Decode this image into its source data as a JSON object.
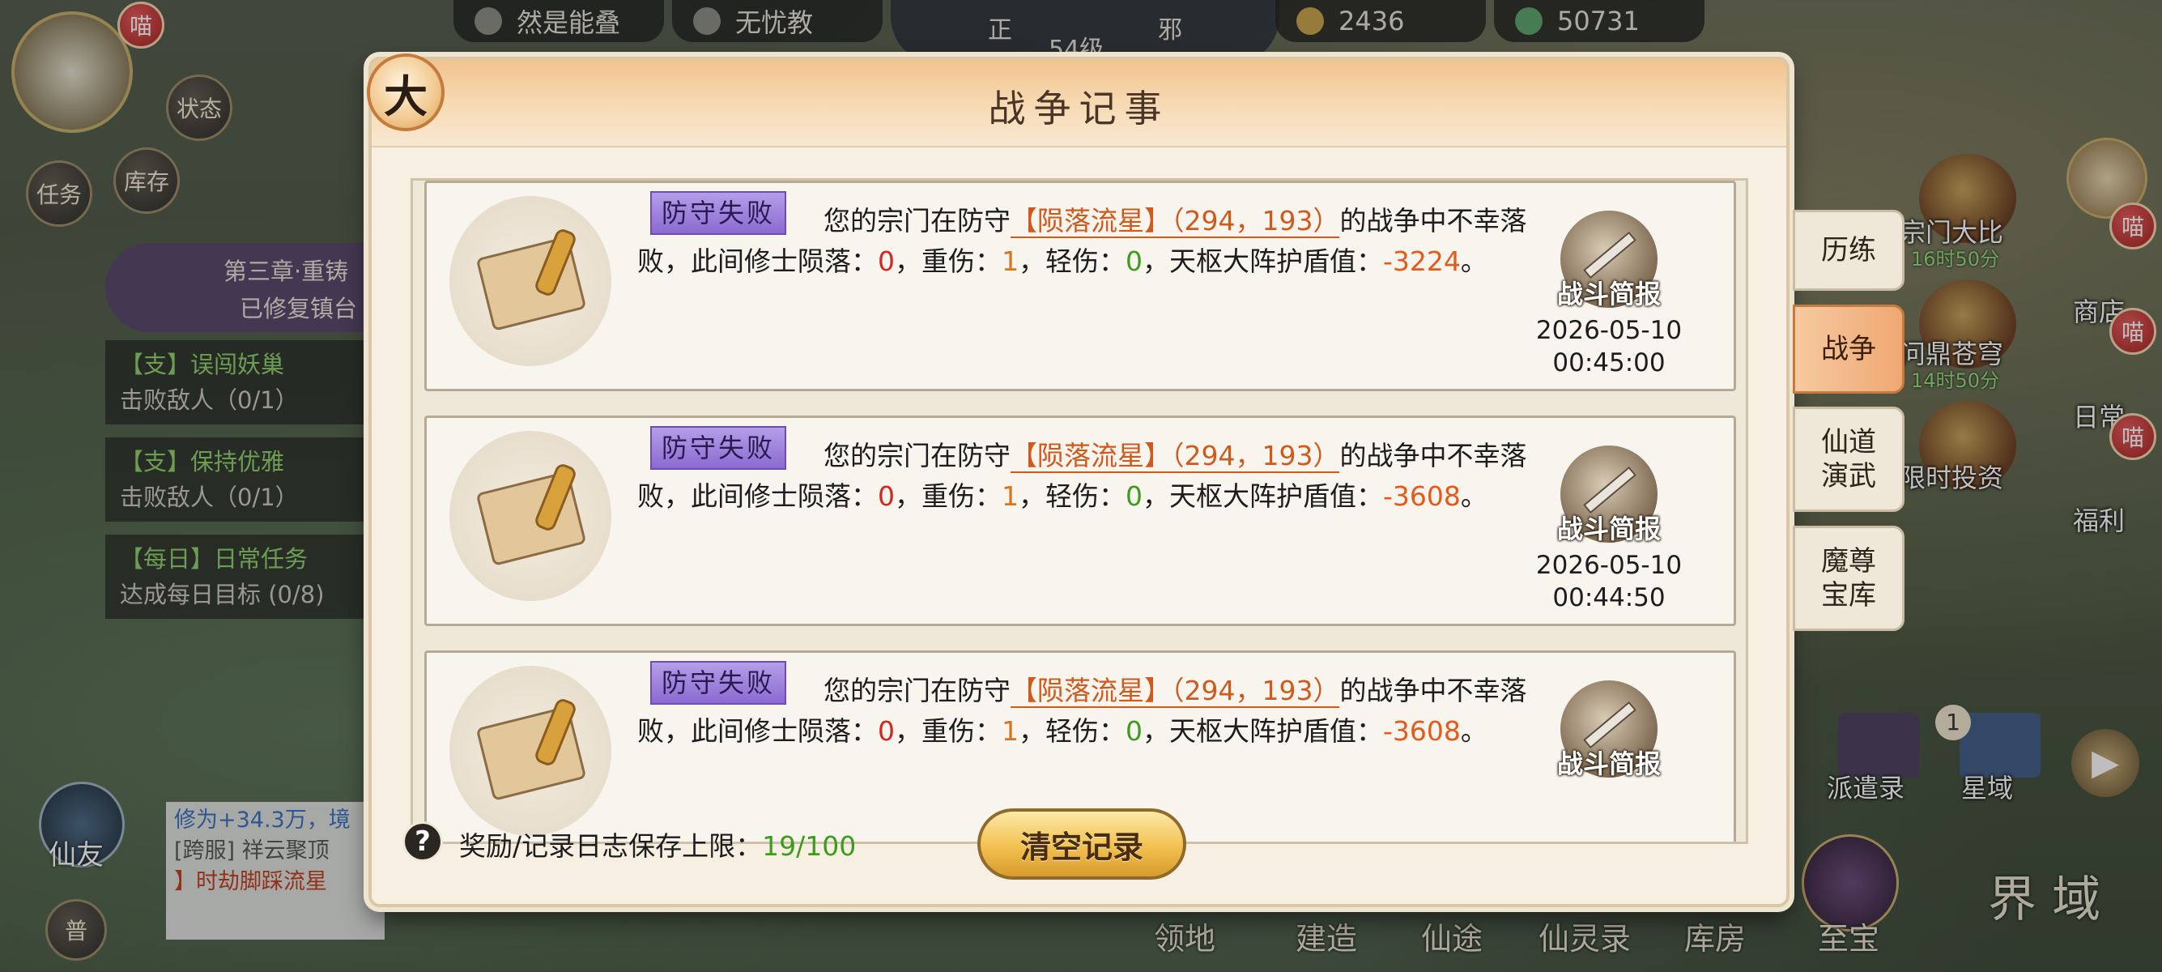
{
  "top_bar": {
    "sect_label": "然是能叠",
    "faction_label": "无忧教",
    "level_label": "54级",
    "alignment_left": "正",
    "alignment_right": "邪",
    "spirit_stones": "2436",
    "currency": "50731"
  },
  "left_hud": {
    "notify_badge": "喵",
    "status_label": "状态",
    "storage_label": "库存",
    "task_label": "任务",
    "chapter_title": "第三章·重铸",
    "chapter_sub": "已修复镇台",
    "quests": [
      {
        "title": "【支】误闯妖巢",
        "desc": "击败敌人（0/1）"
      },
      {
        "title": "【支】保持优雅",
        "desc": "击败敌人（0/1）"
      },
      {
        "title": "【每日】日常任务",
        "desc": "达成每日目标 (0/8)"
      }
    ],
    "friends_label": "仙友",
    "chat_mode": "普",
    "chat_lines": [
      "修为+34.3万，境",
      "[跨服] 祥云聚顶",
      "】时劫脚踩流星"
    ]
  },
  "right_hud": {
    "items": [
      {
        "label": "宗门大比",
        "sub": "16时50分"
      },
      {
        "label": "问鼎苍穹",
        "sub": "14时50分"
      },
      {
        "label": "限时投资",
        "sub": ""
      }
    ],
    "side_items": [
      "商店",
      "日常",
      "福利"
    ],
    "badge": "喵",
    "dispatch_label": "派遣录",
    "star_label": "星域",
    "star_count": "1"
  },
  "bottom_nav": [
    "领地",
    "建造",
    "仙途",
    "仙灵录",
    "库房",
    "至宝",
    "界 域"
  ],
  "modal": {
    "title": "战争记事",
    "close_glyph": "大",
    "tabs": [
      {
        "label": "历练",
        "active": false
      },
      {
        "label": "战争",
        "active": true
      },
      {
        "label": "仙道\n演武",
        "active": false
      },
      {
        "label": "魔尊\n宝库",
        "active": false
      }
    ],
    "entries": [
      {
        "badge": "防守失败",
        "prefix": "您的宗门在防守",
        "location": "【陨落流星】（294，193）",
        "suffix": "的战争中不幸落",
        "l2_a": "败，此间修士陨落：",
        "deaths": "0",
        "l2_b": "，重伤：",
        "heavy": "1",
        "l2_c": "，轻伤：",
        "light": "0",
        "l2_d": "，天枢大阵护盾值：",
        "shield": "-3224",
        "l2_e": "。",
        "report_label": "战斗简报",
        "date": "2026-05-10",
        "time": "00:45:00"
      },
      {
        "badge": "防守失败",
        "prefix": "您的宗门在防守",
        "location": "【陨落流星】（294，193）",
        "suffix": "的战争中不幸落",
        "l2_a": "败，此间修士陨落：",
        "deaths": "0",
        "l2_b": "，重伤：",
        "heavy": "1",
        "l2_c": "，轻伤：",
        "light": "0",
        "l2_d": "，天枢大阵护盾值：",
        "shield": "-3608",
        "l2_e": "。",
        "report_label": "战斗简报",
        "date": "2026-05-10",
        "time": "00:44:50"
      },
      {
        "badge": "防守失败",
        "prefix": "您的宗门在防守",
        "location": "【陨落流星】（294，193）",
        "suffix": "的战争中不幸落",
        "l2_a": "败，此间修士陨落：",
        "deaths": "0",
        "l2_b": "，重伤：",
        "heavy": "1",
        "l2_c": "，轻伤：",
        "light": "0",
        "l2_d": "，天枢大阵护盾值：",
        "shield": "-3608",
        "l2_e": "。",
        "report_label": "战斗简报",
        "date": "",
        "time": ""
      }
    ],
    "footer": {
      "help_glyph": "?",
      "limit_label": "奖励/记录日志保存上限：",
      "limit_value": "19/100",
      "clear_label": "清空记录"
    }
  }
}
